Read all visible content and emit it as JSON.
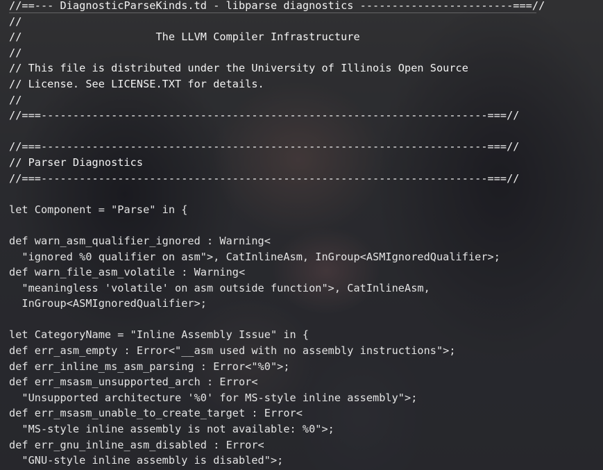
{
  "editor": {
    "file_name": "DiagnosticParseKinds.td",
    "lines": [
      "//==--- DiagnosticParseKinds.td - libparse diagnostics ------------------------===//",
      "//",
      "//                     The LLVM Compiler Infrastructure",
      "//",
      "// This file is distributed under the University of Illinois Open Source",
      "// License. See LICENSE.TXT for details.",
      "//",
      "//===----------------------------------------------------------------------===//",
      "",
      "//===----------------------------------------------------------------------===//",
      "// Parser Diagnostics",
      "//===----------------------------------------------------------------------===//",
      "",
      "let Component = \"Parse\" in {",
      "",
      "def warn_asm_qualifier_ignored : Warning<",
      "  \"ignored %0 qualifier on asm\">, CatInlineAsm, InGroup<ASMIgnoredQualifier>;",
      "def warn_file_asm_volatile : Warning<",
      "  \"meaningless 'volatile' on asm outside function\">, CatInlineAsm,",
      "  InGroup<ASMIgnoredQualifier>;",
      "",
      "let CategoryName = \"Inline Assembly Issue\" in {",
      "def err_asm_empty : Error<\"__asm used with no assembly instructions\">;",
      "def err_inline_ms_asm_parsing : Error<\"%0\">;",
      "def err_msasm_unsupported_arch : Error<",
      "  \"Unsupported architecture '%0' for MS-style inline assembly\">;",
      "def err_msasm_unable_to_create_target : Error<",
      "  \"MS-style inline assembly is not available: %0\">;",
      "def err_gnu_inline_asm_disabled : Error<",
      "  \"GNU-style inline assembly is disabled\">;"
    ]
  },
  "colors": {
    "text": "#e4e4e4",
    "background": "#2a2b30"
  }
}
